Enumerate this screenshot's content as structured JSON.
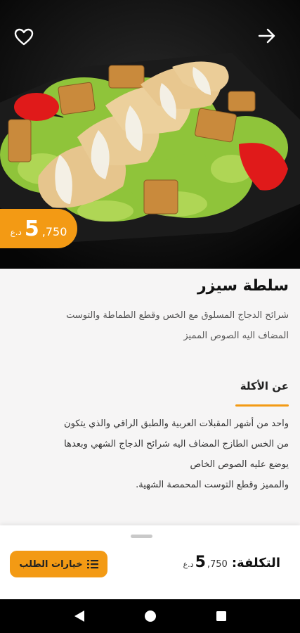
{
  "hero": {
    "image": "caesar-salad-photo",
    "favorite_icon": "heart-outline-icon",
    "back_icon": "arrow-right-icon"
  },
  "price_badge": {
    "currency": "د.ع",
    "major": "5",
    "minor": ",750"
  },
  "dish": {
    "name": "سلطة سيزر",
    "description_lines": [
      "شرائح الدجاج المسلوق مع الخس وقطع الطماطة والتوست",
      "المضاف اليه الصوص المميز"
    ]
  },
  "about": {
    "heading": "عن الأكلة",
    "lines": [
      "واحد من أشهر المقبلات العربية والطبق الراقي والذي يتكون",
      "من الخس الطازج المضاف اليه شرائح الدجاج الشهي وبعدها",
      "يوضع عليه الصوص الخاص",
      "والمميز وقطع التوست المحمصة الشهية."
    ]
  },
  "bottom_sheet": {
    "order_options_label": "خيارات الطلب",
    "order_options_icon": "list-icon",
    "cost_label": "التكلفة:",
    "cost_major": "5",
    "cost_minor": ",750",
    "cost_currency": "د.ع"
  },
  "navbar": {
    "back_icon": "nav-back-triangle-icon",
    "home_icon": "nav-home-circle-icon",
    "recents_icon": "nav-recents-square-icon"
  },
  "colors": {
    "accent": "#f39a14",
    "hero_bg": "#0d0d0d",
    "content_bg": "#f6f5f5"
  }
}
